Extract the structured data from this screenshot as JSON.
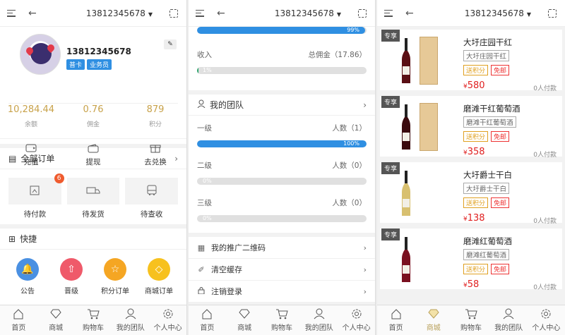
{
  "topbar": {
    "phone": "13812345678"
  },
  "tabs": [
    {
      "label": "首页",
      "icon": "home-icon"
    },
    {
      "label": "商城",
      "icon": "diamond-icon"
    },
    {
      "label": "购物车",
      "icon": "cart-icon"
    },
    {
      "label": "我的团队",
      "icon": "team-icon"
    },
    {
      "label": "个人中心",
      "icon": "gear-icon"
    }
  ],
  "profile": {
    "username": "13812345678",
    "badges": [
      "普卡",
      "业务员"
    ],
    "stats": [
      {
        "value": "10,284.44",
        "label": "余额"
      },
      {
        "value": "0.76",
        "label": "佣金"
      },
      {
        "value": "879",
        "label": "积分"
      }
    ],
    "actions": [
      {
        "label": "充值",
        "icon": "wallet-icon"
      },
      {
        "label": "提现",
        "icon": "purse-icon"
      },
      {
        "label": "去兑换",
        "icon": "gift-icon"
      }
    ]
  },
  "orders": {
    "title": "全部订单",
    "items": [
      {
        "label": "待付款",
        "badge": "6",
        "icon": "pay-icon"
      },
      {
        "label": "待发货",
        "icon": "truck-icon"
      },
      {
        "label": "待查收",
        "icon": "bus-icon"
      }
    ]
  },
  "quick": {
    "title": "快捷",
    "items": [
      {
        "label": "公告",
        "color": "#4a90e2",
        "icon": "bell-icon"
      },
      {
        "label": "晋级",
        "color": "#ef5a6a",
        "icon": "arrow-up-icon"
      },
      {
        "label": "积分订单",
        "color": "#f5a623",
        "icon": "star-icon"
      },
      {
        "label": "商城订单",
        "color": "#f7c11e",
        "icon": "diamond-icon"
      }
    ]
  },
  "earnings": {
    "top_bar_pct": 0.99,
    "top_bar_label": "99%",
    "income_label": "收入",
    "income_total": "总佣金（17.86）",
    "income_pct": 0.01,
    "income_bar_label": "1%"
  },
  "team": {
    "title": "我的团队",
    "levels": [
      {
        "name": "一级",
        "count": "人数（1）",
        "pct": 1.0,
        "label": "100%"
      },
      {
        "name": "二级",
        "count": "人数（0）",
        "pct": 0,
        "label": "0%"
      },
      {
        "name": "三级",
        "count": "人数（0）",
        "pct": 0,
        "label": "0%"
      }
    ]
  },
  "menu": [
    {
      "label": "我的推广二维码",
      "icon": "qr-icon"
    },
    {
      "label": "清空缓存",
      "icon": "broom-icon"
    },
    {
      "label": "注销登录",
      "icon": "lock-icon"
    }
  ],
  "products": [
    {
      "tag": "专享",
      "name": "大圩庄园干红",
      "sub": "大圩庄园干红",
      "t1": "送积分",
      "t2": "免邮",
      "currency": "¥",
      "price": "580",
      "paid": "0人付款",
      "wine": "#5a0f14",
      "hasBox": true
    },
    {
      "tag": "专享",
      "name": "磨滩干红葡萄酒",
      "sub": "磨滩干红葡萄酒",
      "t1": "送积分",
      "t2": "免邮",
      "currency": "¥",
      "price": "358",
      "paid": "0人付款",
      "wine": "#3a0a0e",
      "hasBox": true
    },
    {
      "tag": "专享",
      "name": "大圩爵士干白",
      "sub": "大圩爵士干白",
      "t1": "送积分",
      "t2": "免邮",
      "currency": "¥",
      "price": "138",
      "paid": "0人付款",
      "wine": "#d8c070",
      "hasBox": false
    },
    {
      "tag": "专享",
      "name": "磨滩红葡萄酒",
      "sub": "磨滩红葡萄酒",
      "t1": "送积分",
      "t2": "免邮",
      "currency": "¥",
      "price": "58",
      "paid": "0人付款",
      "wine": "#7a1020",
      "hasBox": false
    }
  ]
}
